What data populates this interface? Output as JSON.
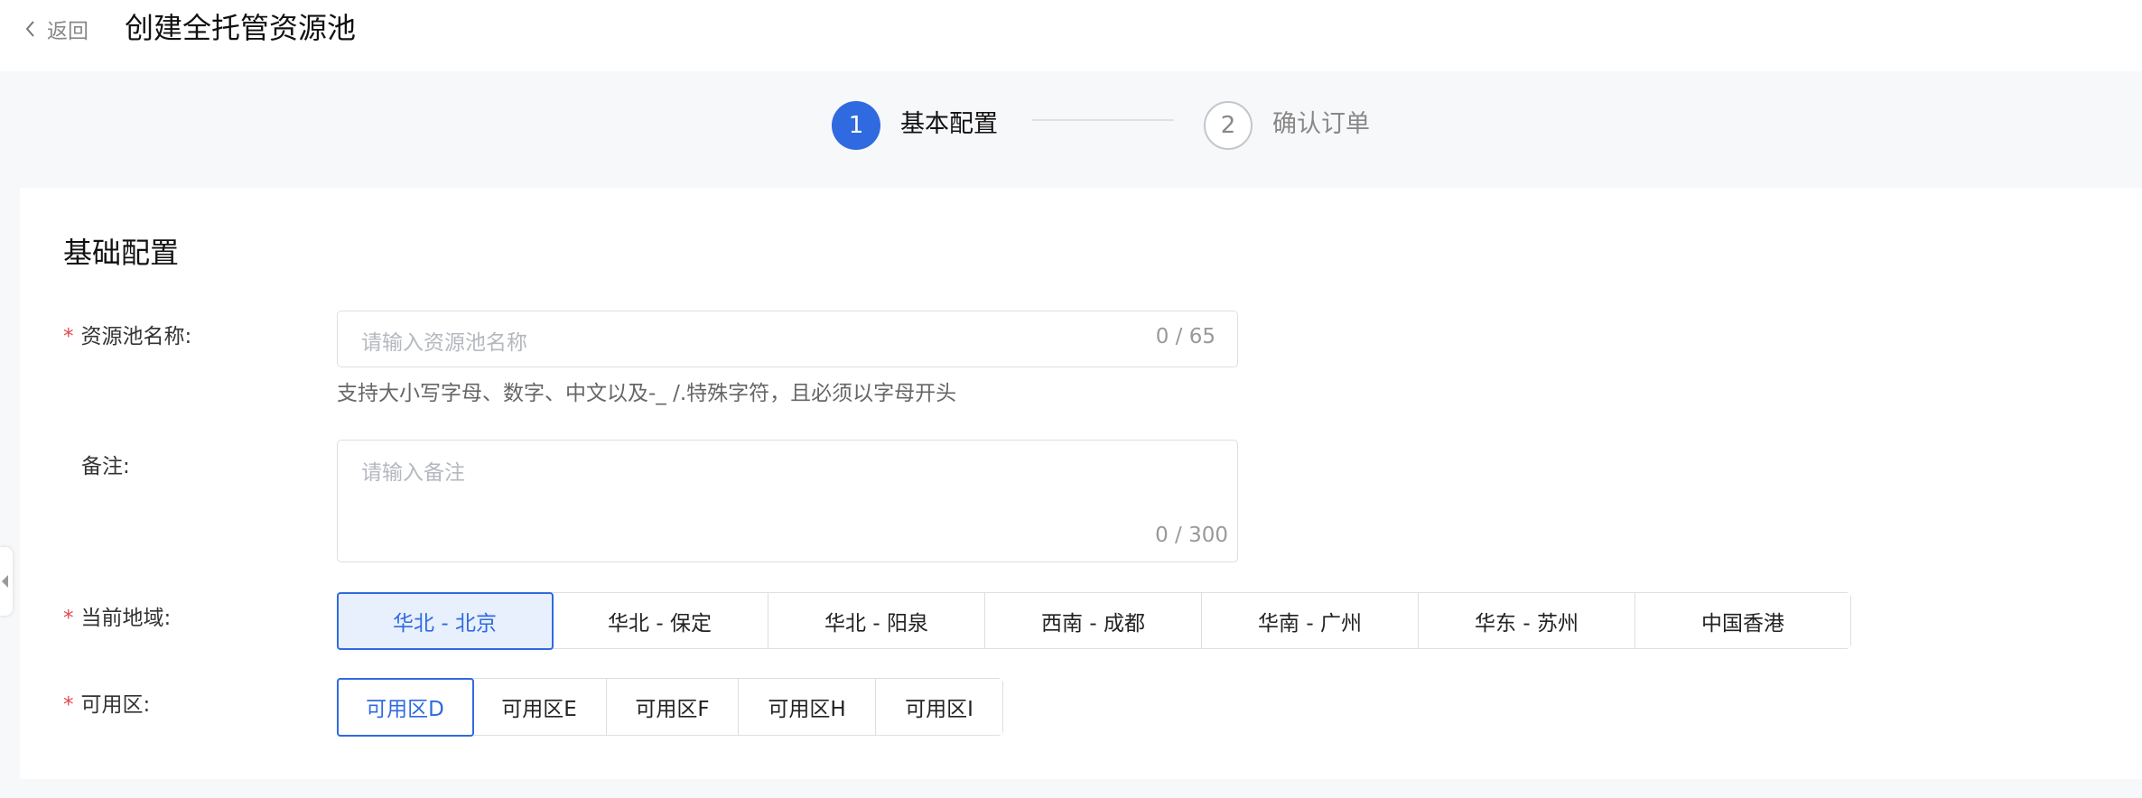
{
  "header": {
    "back_label": "返回",
    "title": "创建全托管资源池"
  },
  "steps": [
    {
      "number": "1",
      "label": "基本配置",
      "active": true
    },
    {
      "number": "2",
      "label": "确认订单",
      "active": false
    }
  ],
  "section": {
    "title": "基础配置"
  },
  "form": {
    "name": {
      "label": "资源池名称:",
      "placeholder": "请输入资源池名称",
      "counter": "0 / 65",
      "hint": "支持大小写字母、数字、中文以及-_ /.特殊字符，且必须以字母开头"
    },
    "remark": {
      "label": "备注:",
      "placeholder": "请输入备注",
      "counter": "0 / 300"
    },
    "region": {
      "label": "当前地域:",
      "options": [
        "华北 - 北京",
        "华北 - 保定",
        "华北 - 阳泉",
        "西南 - 成都",
        "华南 - 广州",
        "华东 - 苏州",
        "中国香港"
      ],
      "selected": "华北 - 北京"
    },
    "zone": {
      "label": "可用区:",
      "options": [
        "可用区D",
        "可用区E",
        "可用区F",
        "可用区H",
        "可用区I"
      ],
      "selected": "可用区D"
    }
  },
  "colors": {
    "accent": "#2f6ae0",
    "required": "#e5484d",
    "page_bg": "#f7f8fa"
  },
  "icons": {
    "back": "chevron-left-icon",
    "sidebar_toggle": "caret-left-icon"
  }
}
